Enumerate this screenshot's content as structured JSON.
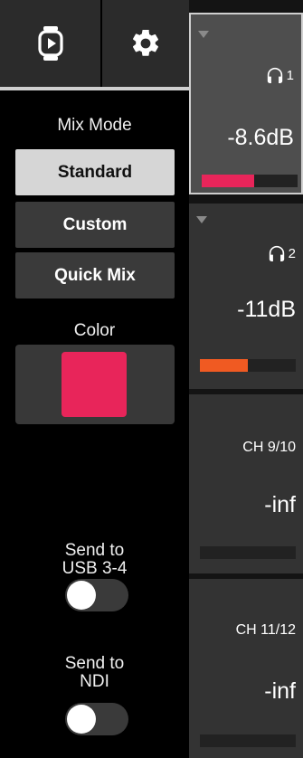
{
  "sidebar": {
    "top_buttons": [
      {
        "icon": "video-device-icon"
      },
      {
        "icon": "gear-icon"
      }
    ],
    "mix_mode_label": "Mix Mode",
    "modes": [
      "Standard",
      "Custom",
      "Quick Mix"
    ],
    "active_mode": "Standard",
    "color_label": "Color",
    "color_value": "#e8255a",
    "send_usb_label_1": "Send to",
    "send_usb_label_2": "USB 3-4",
    "send_usb_on": false,
    "send_ndi_label_1": "Send to",
    "send_ndi_label_2": "NDI",
    "send_ndi_on": false
  },
  "channels": [
    {
      "type": "headphone",
      "number": "1",
      "level": "-8.6dB",
      "meter_fraction": 0.55,
      "meter_color": "#e8255a",
      "selected": true
    },
    {
      "type": "headphone",
      "number": "2",
      "level": "-11dB",
      "meter_fraction": 0.5,
      "meter_color": "#f05a22",
      "selected": false
    },
    {
      "type": "channel",
      "name": "CH 9/10",
      "level": "-inf",
      "meter_fraction": 0,
      "selected": false
    },
    {
      "type": "channel",
      "name": "CH 11/12",
      "level": "-inf",
      "meter_fraction": 0,
      "selected": false
    }
  ]
}
